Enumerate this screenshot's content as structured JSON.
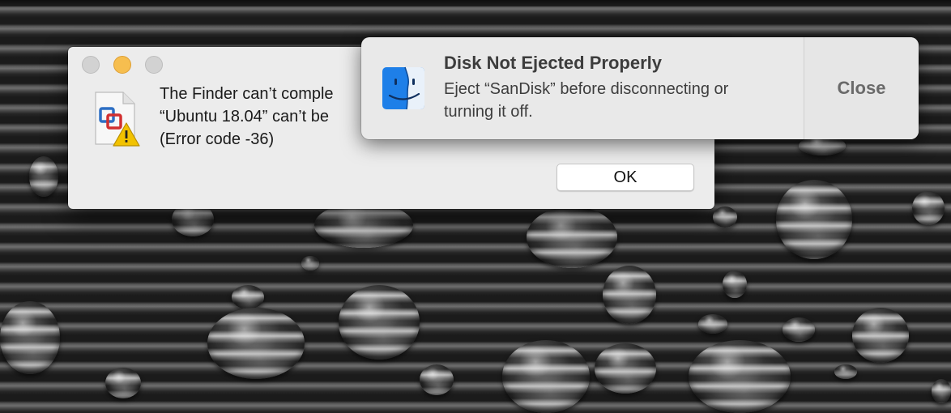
{
  "desktop": {
    "wallpaper_description": "",
    "accent_color": "#f6be4f"
  },
  "error_dialog": {
    "icon": "vmware-fusion-warning-icon",
    "message_lines": [
      "The Finder can’t comple",
      "“Ubuntu 18.04” can’t be",
      "(Error code -36)"
    ],
    "ok_label": "OK"
  },
  "notification": {
    "icon": "finder-icon",
    "title": "Disk Not Ejected Properly",
    "body_lines": [
      "Eject “SanDisk” before disconnecting or",
      "turning it off."
    ],
    "close_label": "Close"
  }
}
